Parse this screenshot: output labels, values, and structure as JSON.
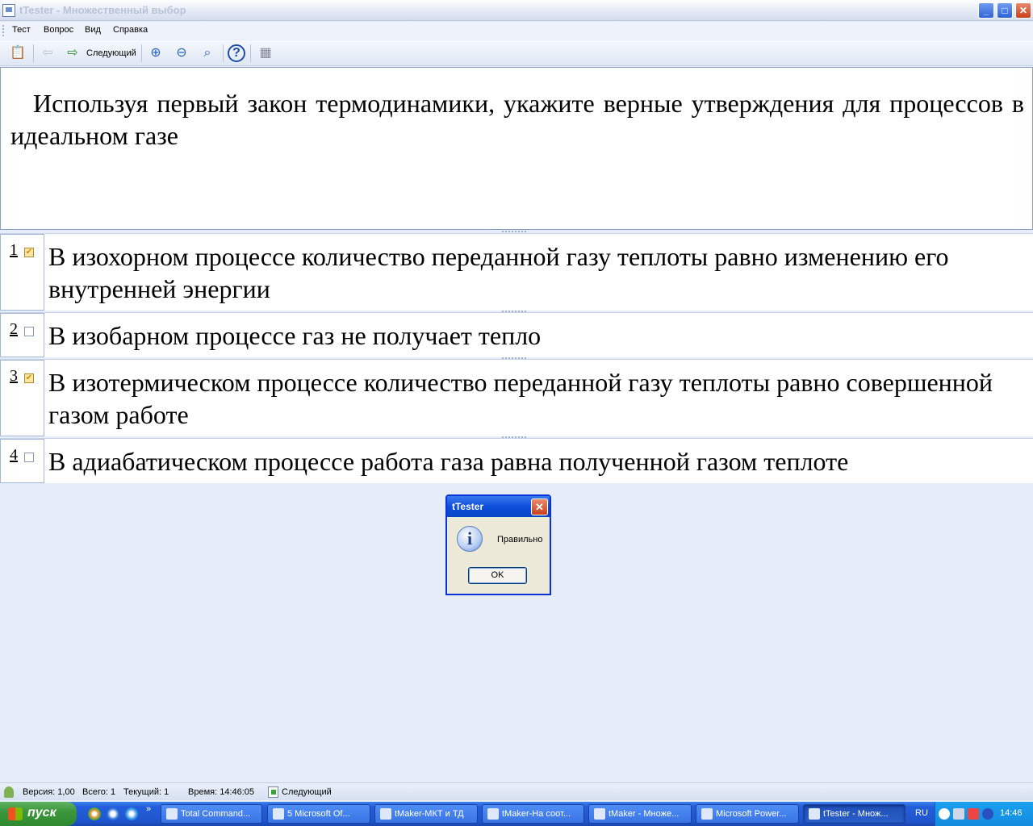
{
  "window": {
    "title": "tTester - Множественный выбор",
    "min_glyph": "_",
    "max_glyph": "□",
    "close_glyph": "✕"
  },
  "menu": [
    "Тест",
    "Вопрос",
    "Вид",
    "Справка"
  ],
  "toolbar": {
    "next_label": "Следующий",
    "icons": [
      "test-icon",
      "back-icon",
      "next-icon",
      "zoom-in-icon",
      "zoom-out-icon",
      "zoom-icon",
      "help-icon",
      "calculator-icon"
    ]
  },
  "question": {
    "text": "Используя первый закон термодинамики, укажите верные утверждения для процессов в идеальном газе"
  },
  "answers": [
    {
      "num": "1",
      "checked": true,
      "text": "В изохорном процессе количество переданной газу теплоты равно изменению его внутренней энергии"
    },
    {
      "num": "2",
      "checked": false,
      "text": "В изобарном процессе газ не получает тепло"
    },
    {
      "num": "3",
      "checked": true,
      "text": "В изотермическом процессе количество переданной газу теплоты равно совершенной газом работе"
    },
    {
      "num": "4",
      "checked": false,
      "text": "В адиабатическом процессе работа газа равна полученной газом теплоте"
    }
  ],
  "dialog": {
    "title": "tTester",
    "message": "Правильно",
    "ok_label": "OK",
    "icon": "info-icon"
  },
  "status": {
    "version": "Версия: 1,00",
    "total": "Всего: 1",
    "current": "Текущий: 1",
    "time": "Время: 14:46:05",
    "next": "Следующий"
  },
  "taskbar": {
    "start_label": "пуск",
    "tasks": [
      "Total Command...",
      "5 Microsoft Of...",
      "tMaker-МКТ и ТД",
      "tMaker-На соот...",
      "tMaker - Множе...",
      "Microsoft Power...",
      "tTester - Множ..."
    ],
    "lang": "RU",
    "clock": "14:46"
  },
  "colors": {
    "accent": "#0831d9",
    "checked_fill": "#fde7a6",
    "taskbar": "#245edb"
  }
}
